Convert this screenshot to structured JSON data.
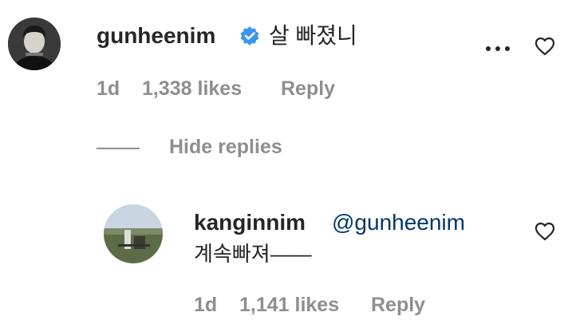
{
  "comment": {
    "username": "gunheenim",
    "text": "살 빠졌니",
    "time": "1d",
    "likes": "1,338 likes",
    "reply_label": "Reply",
    "verified": true
  },
  "replies_toggle": {
    "label": "Hide replies"
  },
  "reply": {
    "username": "kanginnim",
    "mention": "@gunheenim",
    "text": "계속빠져——",
    "time": "1d",
    "likes": "1,141 likes",
    "reply_label": "Reply"
  },
  "colors": {
    "username": "#262626",
    "meta": "#8e8e8e",
    "mention": "#00376b",
    "verified": "#3897f0",
    "divider": "#8e8e8e"
  },
  "icons": {
    "verified": "verified-badge-icon",
    "more": "more-options-icon",
    "like": "heart-icon"
  }
}
